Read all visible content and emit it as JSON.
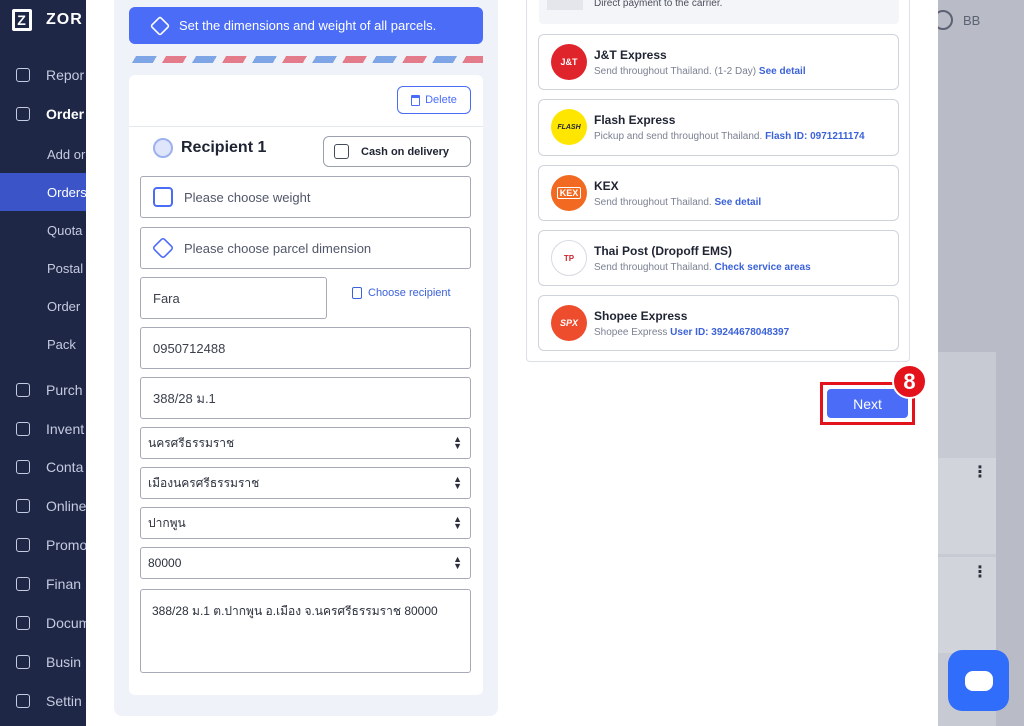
{
  "sidebar": {
    "logo_text": "ZOR",
    "items": [
      {
        "label": "Repor",
        "top": 0
      },
      {
        "label": "Order"
      },
      {
        "label": "Add or"
      },
      {
        "label": "Orders"
      },
      {
        "label": "Quota"
      },
      {
        "label": "Postal"
      },
      {
        "label": "Order"
      },
      {
        "label": "Pack"
      },
      {
        "label": "Purch"
      },
      {
        "label": "Invent"
      },
      {
        "label": "Conta"
      },
      {
        "label": "Online"
      },
      {
        "label": "Promo"
      },
      {
        "label": "Finan"
      },
      {
        "label": "Docum"
      },
      {
        "label": "Busin"
      },
      {
        "label": "Settin"
      }
    ]
  },
  "topbar": {
    "user_initials": "BB"
  },
  "banner": {
    "text": "Set the dimensions and weight of all parcels."
  },
  "recipient": {
    "delete_label": "Delete",
    "title": "Recipient 1",
    "cod_label": "Cash on delivery",
    "weight_placeholder": "Please choose weight",
    "dimension_placeholder": "Please choose parcel dimension",
    "name_value": "Fara",
    "choose_recipient_label": "Choose recipient",
    "phone_value": "0950712488",
    "address_value": "388/28 ม.1",
    "province_value": "นครศรีธรรมราช",
    "district_value": "เมืองนครศรีธรรมราช",
    "subdistrict_value": "ปากพูน",
    "postcode_value": "80000",
    "full_address": "388/28 ม.1 ต.ปากพูน อ.เมือง จ.นครศรีธรรมราช 80000"
  },
  "carriers": {
    "top_snippet": "Direct payment to the carrier.",
    "list": [
      {
        "name": "J&T Express",
        "desc": "Send throughout Thailand. (1-2 Day)",
        "link": "See detail",
        "logo_text": "J&T",
        "logo_color": "#e0242c"
      },
      {
        "name": "Flash Express",
        "desc": "Pickup and send throughout Thailand.",
        "link": "Flash ID: 0971211174",
        "logo_text": "FLASH",
        "logo_color": "#ffe600"
      },
      {
        "name": "KEX",
        "desc": "Send throughout Thailand.",
        "link": "See detail",
        "logo_text": "KEX",
        "logo_color": "#f26a21"
      },
      {
        "name": "Thai Post (Dropoff EMS)",
        "desc": "Send throughout Thailand.",
        "link": "Check service areas",
        "logo_text": "TP",
        "logo_color": "#ffffff"
      },
      {
        "name": "Shopee Express",
        "desc": "Shopee Express",
        "link": "User ID: 39244678048397",
        "logo_text": "SPX",
        "logo_color": "#ee4d2d"
      }
    ]
  },
  "next_label": "Next",
  "step_number": "8"
}
